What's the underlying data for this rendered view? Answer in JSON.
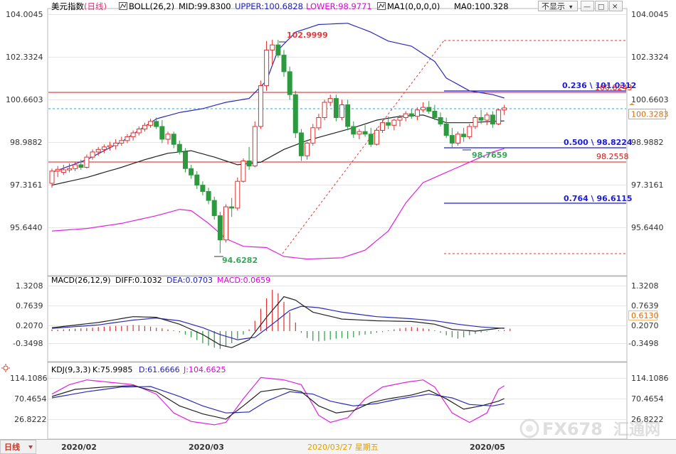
{
  "header": {
    "main_title": "美元指数",
    "period": "(日线)",
    "boll_label": "BOLL(26,2)",
    "boll_mid": "MID:99.8300",
    "boll_upper": "UPPER:100.6828",
    "boll_lower": "LOWER:98.9771",
    "ma_label": "MA1(0,0,0,0)",
    "ma_value": "MA0:100.328",
    "hide_label": "不显示",
    "hide_arrow": "▾",
    "colors": {
      "title": "#000000",
      "boll_mid": "#000000",
      "boll_upper": "#2020c0",
      "boll_lower": "#e000e0"
    }
  },
  "window_controls": {
    "minimize": "—",
    "maximize": "□",
    "close": "✕"
  },
  "main_axis": {
    "ticks": [
      "104.0045",
      "102.3324",
      "100.6603",
      "98.9882",
      "97.3161",
      "95.6440"
    ],
    "current_price": "100.3283"
  },
  "annotations": {
    "high": "102.9999",
    "low": "94.6282",
    "pivot_low": "98.7659",
    "fib_236": "0.236 \\ 101.0312",
    "fib_500": "0.500 \\ 98.8224",
    "fib_764": "0.764 \\ 96.6115",
    "fib_overlap": "100.8243",
    "line_98": "98.2558"
  },
  "macd": {
    "label": "MACD(26,12,9)",
    "diff": "DIFF:0.1032",
    "dea": "DEA:0.0703",
    "macd": "MACD:0.0659",
    "ticks": [
      "1.3208",
      "0.7639",
      "0.2070",
      "-0.3498"
    ],
    "current": "0.6130"
  },
  "kdj": {
    "label": "KDJ(9,3,3)",
    "k": "K:75.9985",
    "d": "D:61.6666",
    "j": "J:104.6625",
    "ticks": [
      "114.1086",
      "70.4654",
      "26.8222"
    ]
  },
  "x_axis": {
    "period_button": "日线",
    "labels": [
      "2020/02",
      "2020/03",
      "2020/03/27 星期五",
      "2020/05"
    ]
  },
  "watermark": {
    "brand": "FX678",
    "name": "汇通网"
  },
  "chart_data": {
    "type": "candlestick",
    "title": "美元指数 (日线)",
    "ylim": [
      94.2,
      104.3
    ],
    "candles": [
      {
        "o": 97.37,
        "h": 97.95,
        "l": 97.2,
        "c": 97.85
      },
      {
        "o": 97.85,
        "h": 98.05,
        "l": 97.62,
        "c": 97.92
      },
      {
        "o": 97.8,
        "h": 98.1,
        "l": 97.7,
        "c": 97.9
      },
      {
        "o": 97.9,
        "h": 98.15,
        "l": 97.8,
        "c": 97.95
      },
      {
        "o": 97.95,
        "h": 98.2,
        "l": 97.85,
        "c": 98.1
      },
      {
        "o": 98.1,
        "h": 98.3,
        "l": 97.9,
        "c": 98.0
      },
      {
        "o": 98.0,
        "h": 98.5,
        "l": 97.95,
        "c": 98.4
      },
      {
        "o": 98.4,
        "h": 98.7,
        "l": 98.3,
        "c": 98.6
      },
      {
        "o": 98.6,
        "h": 98.8,
        "l": 98.45,
        "c": 98.7
      },
      {
        "o": 98.7,
        "h": 98.9,
        "l": 98.55,
        "c": 98.8
      },
      {
        "o": 98.8,
        "h": 99.0,
        "l": 98.65,
        "c": 98.85
      },
      {
        "o": 98.85,
        "h": 99.1,
        "l": 98.7,
        "c": 98.95
      },
      {
        "o": 98.95,
        "h": 99.2,
        "l": 98.85,
        "c": 99.05
      },
      {
        "o": 99.05,
        "h": 99.3,
        "l": 98.95,
        "c": 99.2
      },
      {
        "o": 99.2,
        "h": 99.45,
        "l": 99.05,
        "c": 99.35
      },
      {
        "o": 99.35,
        "h": 99.6,
        "l": 99.25,
        "c": 99.5
      },
      {
        "o": 99.5,
        "h": 99.75,
        "l": 99.4,
        "c": 99.65
      },
      {
        "o": 99.65,
        "h": 99.9,
        "l": 99.55,
        "c": 99.8
      },
      {
        "o": 99.8,
        "h": 99.95,
        "l": 99.5,
        "c": 99.6
      },
      {
        "o": 99.6,
        "h": 99.85,
        "l": 98.95,
        "c": 99.1
      },
      {
        "o": 99.1,
        "h": 99.4,
        "l": 98.9,
        "c": 99.3
      },
      {
        "o": 99.3,
        "h": 99.4,
        "l": 98.75,
        "c": 98.9
      },
      {
        "o": 98.9,
        "h": 99.05,
        "l": 98.5,
        "c": 98.6
      },
      {
        "o": 98.6,
        "h": 98.75,
        "l": 97.8,
        "c": 97.95
      },
      {
        "o": 97.95,
        "h": 98.1,
        "l": 97.55,
        "c": 97.7
      },
      {
        "o": 97.7,
        "h": 97.85,
        "l": 97.15,
        "c": 97.3
      },
      {
        "o": 97.3,
        "h": 97.45,
        "l": 96.9,
        "c": 97.05
      },
      {
        "o": 97.05,
        "h": 97.2,
        "l": 96.55,
        "c": 96.7
      },
      {
        "o": 96.7,
        "h": 96.85,
        "l": 95.95,
        "c": 96.1
      },
      {
        "o": 96.1,
        "h": 96.25,
        "l": 94.63,
        "c": 95.15
      },
      {
        "o": 95.15,
        "h": 96.55,
        "l": 95.05,
        "c": 96.45
      },
      {
        "o": 96.45,
        "h": 96.8,
        "l": 96.05,
        "c": 96.4
      },
      {
        "o": 96.4,
        "h": 97.6,
        "l": 96.3,
        "c": 97.45
      },
      {
        "o": 97.45,
        "h": 98.35,
        "l": 97.4,
        "c": 98.25
      },
      {
        "o": 98.25,
        "h": 98.8,
        "l": 97.9,
        "c": 98.05
      },
      {
        "o": 98.05,
        "h": 99.8,
        "l": 98.0,
        "c": 99.6
      },
      {
        "o": 99.6,
        "h": 101.4,
        "l": 99.5,
        "c": 101.2
      },
      {
        "o": 101.2,
        "h": 102.95,
        "l": 101.0,
        "c": 102.6
      },
      {
        "o": 102.6,
        "h": 103.0,
        "l": 102.0,
        "c": 102.8
      },
      {
        "o": 102.8,
        "h": 103.0,
        "l": 102.3,
        "c": 102.4
      },
      {
        "o": 102.4,
        "h": 102.6,
        "l": 101.55,
        "c": 101.75
      },
      {
        "o": 101.75,
        "h": 101.95,
        "l": 100.65,
        "c": 100.85
      },
      {
        "o": 100.85,
        "h": 101.0,
        "l": 99.15,
        "c": 99.35
      },
      {
        "o": 99.35,
        "h": 99.5,
        "l": 98.25,
        "c": 98.45
      },
      {
        "o": 98.45,
        "h": 99.0,
        "l": 98.3,
        "c": 98.95
      },
      {
        "o": 98.95,
        "h": 99.7,
        "l": 98.85,
        "c": 99.55
      },
      {
        "o": 99.55,
        "h": 100.1,
        "l": 99.45,
        "c": 99.95
      },
      {
        "o": 99.95,
        "h": 100.65,
        "l": 99.85,
        "c": 100.55
      },
      {
        "o": 100.55,
        "h": 100.85,
        "l": 100.4,
        "c": 100.7
      },
      {
        "o": 100.7,
        "h": 100.85,
        "l": 99.8,
        "c": 99.95
      },
      {
        "o": 99.95,
        "h": 100.65,
        "l": 99.85,
        "c": 100.45
      },
      {
        "o": 100.45,
        "h": 100.65,
        "l": 99.45,
        "c": 99.6
      },
      {
        "o": 99.6,
        "h": 99.8,
        "l": 99.15,
        "c": 99.3
      },
      {
        "o": 99.3,
        "h": 99.5,
        "l": 99.1,
        "c": 99.4
      },
      {
        "o": 99.4,
        "h": 99.65,
        "l": 99.2,
        "c": 99.3
      },
      {
        "o": 99.3,
        "h": 99.55,
        "l": 98.8,
        "c": 98.9
      },
      {
        "o": 98.9,
        "h": 99.55,
        "l": 98.85,
        "c": 99.45
      },
      {
        "o": 99.45,
        "h": 99.85,
        "l": 99.35,
        "c": 99.75
      },
      {
        "o": 99.75,
        "h": 100.0,
        "l": 99.5,
        "c": 99.65
      },
      {
        "o": 99.65,
        "h": 99.9,
        "l": 99.45,
        "c": 99.85
      },
      {
        "o": 99.85,
        "h": 100.05,
        "l": 99.6,
        "c": 99.95
      },
      {
        "o": 99.95,
        "h": 100.2,
        "l": 99.8,
        "c": 100.1
      },
      {
        "o": 100.1,
        "h": 100.3,
        "l": 99.9,
        "c": 100.0
      },
      {
        "o": 100.0,
        "h": 100.35,
        "l": 99.85,
        "c": 100.25
      },
      {
        "o": 100.25,
        "h": 100.55,
        "l": 100.15,
        "c": 100.35
      },
      {
        "o": 100.35,
        "h": 100.6,
        "l": 100.1,
        "c": 100.2
      },
      {
        "o": 100.2,
        "h": 100.45,
        "l": 99.85,
        "c": 99.95
      },
      {
        "o": 99.95,
        "h": 100.15,
        "l": 99.6,
        "c": 99.7
      },
      {
        "o": 99.7,
        "h": 99.95,
        "l": 99.15,
        "c": 99.25
      },
      {
        "o": 99.25,
        "h": 99.55,
        "l": 98.77,
        "c": 98.95
      },
      {
        "o": 98.95,
        "h": 99.4,
        "l": 98.85,
        "c": 99.3
      },
      {
        "o": 99.3,
        "h": 99.55,
        "l": 99.0,
        "c": 99.2
      },
      {
        "o": 99.2,
        "h": 99.7,
        "l": 99.1,
        "c": 99.6
      },
      {
        "o": 99.6,
        "h": 100.05,
        "l": 99.5,
        "c": 99.95
      },
      {
        "o": 99.95,
        "h": 100.25,
        "l": 99.7,
        "c": 99.85
      },
      {
        "o": 99.85,
        "h": 100.15,
        "l": 99.65,
        "c": 100.05
      },
      {
        "o": 100.05,
        "h": 100.2,
        "l": 99.55,
        "c": 99.7
      },
      {
        "o": 99.7,
        "h": 100.3,
        "l": 99.65,
        "c": 100.25
      },
      {
        "o": 100.25,
        "h": 100.45,
        "l": 100.05,
        "c": 100.33
      }
    ],
    "boll_upper": [
      [
        0,
        97.8
      ],
      [
        6,
        98.3
      ],
      [
        12,
        99.0
      ],
      [
        18,
        99.9
      ],
      [
        22,
        100.15
      ],
      [
        26,
        100.3
      ],
      [
        30,
        100.55
      ],
      [
        34,
        100.7
      ],
      [
        37,
        101.4
      ],
      [
        39,
        102.6
      ],
      [
        42,
        103.3
      ],
      [
        46,
        103.6
      ],
      [
        51,
        103.65
      ],
      [
        55,
        103.3
      ],
      [
        58,
        102.95
      ],
      [
        62,
        102.75
      ],
      [
        66,
        102.15
      ],
      [
        68,
        101.5
      ],
      [
        72,
        101.0
      ],
      [
        76,
        100.85
      ],
      [
        79,
        100.65
      ]
    ],
    "boll_lower": [
      [
        0,
        95.5
      ],
      [
        6,
        95.6
      ],
      [
        12,
        95.8
      ],
      [
        18,
        96.1
      ],
      [
        22,
        96.35
      ],
      [
        24,
        96.3
      ],
      [
        27,
        95.8
      ],
      [
        30,
        95.2
      ],
      [
        33,
        94.9
      ],
      [
        37,
        94.85
      ],
      [
        40,
        94.5
      ],
      [
        44,
        94.4
      ],
      [
        50,
        94.45
      ],
      [
        54,
        94.75
      ],
      [
        58,
        95.5
      ],
      [
        61,
        96.6
      ],
      [
        64,
        97.4
      ],
      [
        68,
        97.8
      ],
      [
        72,
        98.2
      ],
      [
        76,
        98.6
      ],
      [
        79,
        98.8
      ]
    ],
    "boll_mid": [
      [
        0,
        97.3
      ],
      [
        6,
        97.6
      ],
      [
        12,
        98.0
      ],
      [
        16,
        98.3
      ],
      [
        20,
        98.55
      ],
      [
        24,
        98.65
      ],
      [
        28,
        98.4
      ],
      [
        32,
        98.1
      ],
      [
        36,
        98.2
      ],
      [
        40,
        98.7
      ],
      [
        44,
        99.05
      ],
      [
        48,
        99.3
      ],
      [
        52,
        99.55
      ],
      [
        56,
        99.85
      ],
      [
        60,
        100.0
      ],
      [
        64,
        100.05
      ],
      [
        68,
        99.75
      ],
      [
        72,
        99.75
      ],
      [
        76,
        99.8
      ],
      [
        79,
        99.83
      ]
    ],
    "macd_ylim": [
      -0.75,
      1.55
    ],
    "macd_hist": [
      0.05,
      0.04,
      0.05,
      0.06,
      0.07,
      0.08,
      0.09,
      0.1,
      0.12,
      0.13,
      0.14,
      0.15,
      0.15,
      0.16,
      0.18,
      0.17,
      0.15,
      0.13,
      0.1,
      0.08,
      0.05,
      0.02,
      -0.04,
      -0.1,
      -0.18,
      -0.26,
      -0.35,
      -0.42,
      -0.48,
      -0.52,
      -0.45,
      -0.35,
      -0.22,
      -0.1,
      0.05,
      0.3,
      0.65,
      0.95,
      1.2,
      1.1,
      0.85,
      0.55,
      0.25,
      -0.05,
      -0.2,
      -0.28,
      -0.3,
      -0.28,
      -0.25,
      -0.22,
      -0.2,
      -0.22,
      -0.18,
      -0.12,
      -0.1,
      -0.08,
      -0.05,
      -0.03,
      0.02,
      0.05,
      0.08,
      0.1,
      0.12,
      0.1,
      0.08,
      0.06,
      0.02,
      -0.05,
      -0.12,
      -0.18,
      -0.22,
      -0.18,
      -0.12,
      -0.08,
      -0.04,
      -0.02,
      0.0,
      0.02,
      0.03,
      0.07
    ],
    "macd_diff": [
      [
        0,
        0.1
      ],
      [
        8,
        0.25
      ],
      [
        14,
        0.42
      ],
      [
        18,
        0.4
      ],
      [
        22,
        0.2
      ],
      [
        26,
        -0.1
      ],
      [
        29,
        -0.4
      ],
      [
        31,
        -0.48
      ],
      [
        34,
        -0.25
      ],
      [
        37,
        0.4
      ],
      [
        40,
        1.0
      ],
      [
        42,
        0.9
      ],
      [
        45,
        0.55
      ],
      [
        50,
        0.35
      ],
      [
        56,
        0.3
      ],
      [
        62,
        0.28
      ],
      [
        66,
        0.2
      ],
      [
        69,
        0.05
      ],
      [
        73,
        0.0
      ],
      [
        77,
        0.08
      ],
      [
        79,
        0.1
      ]
    ],
    "macd_dea": [
      [
        0,
        0.08
      ],
      [
        8,
        0.18
      ],
      [
        14,
        0.32
      ],
      [
        18,
        0.38
      ],
      [
        22,
        0.3
      ],
      [
        26,
        0.1
      ],
      [
        29,
        -0.1
      ],
      [
        32,
        -0.25
      ],
      [
        35,
        -0.18
      ],
      [
        38,
        0.2
      ],
      [
        41,
        0.6
      ],
      [
        43,
        0.72
      ],
      [
        46,
        0.68
      ],
      [
        50,
        0.55
      ],
      [
        56,
        0.42
      ],
      [
        62,
        0.36
      ],
      [
        66,
        0.3
      ],
      [
        70,
        0.2
      ],
      [
        74,
        0.12
      ],
      [
        77,
        0.09
      ],
      [
        79,
        0.07
      ]
    ],
    "kdj_ylim": [
      10,
      125
    ],
    "kdj_k": [
      [
        0,
        75
      ],
      [
        4,
        90
      ],
      [
        9,
        95
      ],
      [
        14,
        98
      ],
      [
        18,
        85
      ],
      [
        22,
        55
      ],
      [
        26,
        38
      ],
      [
        30,
        27
      ],
      [
        33,
        55
      ],
      [
        36,
        85
      ],
      [
        40,
        92
      ],
      [
        43,
        85
      ],
      [
        46,
        55
      ],
      [
        49,
        40
      ],
      [
        52,
        45
      ],
      [
        55,
        62
      ],
      [
        58,
        70
      ],
      [
        62,
        78
      ],
      [
        65,
        88
      ],
      [
        68,
        70
      ],
      [
        71,
        48
      ],
      [
        74,
        55
      ],
      [
        77,
        65
      ],
      [
        79,
        76
      ]
    ],
    "kdj_d": [
      [
        0,
        72
      ],
      [
        6,
        85
      ],
      [
        12,
        95
      ],
      [
        17,
        96
      ],
      [
        22,
        75
      ],
      [
        26,
        55
      ],
      [
        30,
        40
      ],
      [
        34,
        42
      ],
      [
        37,
        65
      ],
      [
        41,
        85
      ],
      [
        45,
        80
      ],
      [
        48,
        65
      ],
      [
        52,
        55
      ],
      [
        56,
        60
      ],
      [
        60,
        70
      ],
      [
        65,
        80
      ],
      [
        69,
        72
      ],
      [
        72,
        58
      ],
      [
        76,
        55
      ],
      [
        79,
        62
      ]
    ],
    "kdj_j": [
      [
        0,
        80
      ],
      [
        3,
        100
      ],
      [
        6,
        110
      ],
      [
        10,
        105
      ],
      [
        14,
        100
      ],
      [
        18,
        80
      ],
      [
        21,
        40
      ],
      [
        24,
        22
      ],
      [
        28,
        15
      ],
      [
        30,
        20
      ],
      [
        33,
        70
      ],
      [
        36,
        115
      ],
      [
        40,
        110
      ],
      [
        43,
        100
      ],
      [
        46,
        35
      ],
      [
        48,
        20
      ],
      [
        51,
        30
      ],
      [
        54,
        70
      ],
      [
        57,
        95
      ],
      [
        61,
        105
      ],
      [
        64,
        110
      ],
      [
        66,
        95
      ],
      [
        69,
        40
      ],
      [
        72,
        20
      ],
      [
        75,
        40
      ],
      [
        77,
        90
      ],
      [
        79,
        105
      ]
    ]
  }
}
